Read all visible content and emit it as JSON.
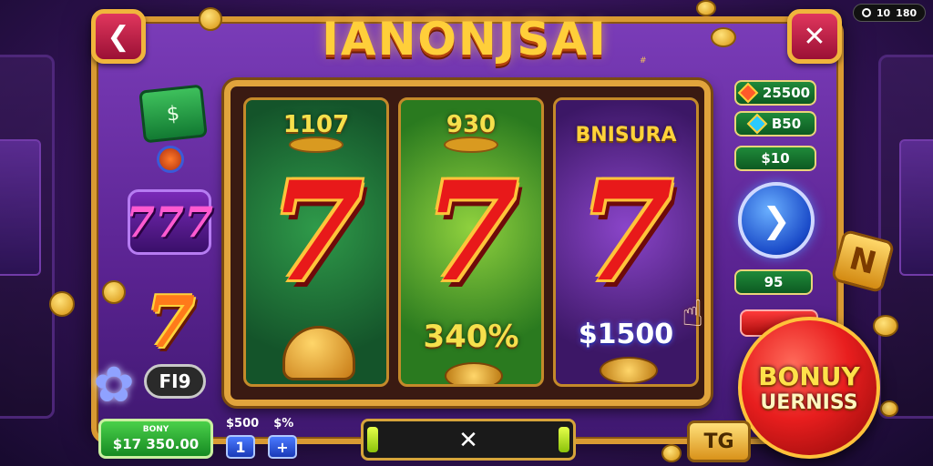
{
  "header": {
    "title": "IANONJSAI",
    "title_sub": "#",
    "back_icon": "chevron-left-icon",
    "close_icon": "close-icon",
    "counter": {
      "left": "10",
      "right": "180"
    }
  },
  "reels": [
    {
      "top": "1107",
      "symbol": "7",
      "bottom": ""
    },
    {
      "top": "930",
      "symbol": "7",
      "bottom": "340%"
    },
    {
      "top": "BNISURA",
      "symbol": "7",
      "bottom": "$1500"
    }
  ],
  "left_icons": {
    "cash_icon": "cash-icon",
    "label_777": "777",
    "label_7": "7",
    "flower": "✿",
    "fid_button": "FI9"
  },
  "paytable": [
    {
      "icon": "gem-icon",
      "value": "25500"
    },
    {
      "icon": "gem-icon",
      "value": "B50"
    },
    {
      "icon": "none",
      "value": "$10"
    },
    {
      "icon": "none",
      "value": "95"
    }
  ],
  "spin_icon": "chevron-right-icon",
  "bonus": {
    "line1": "BONUY",
    "line2": "UERNISS"
  },
  "floating_block": "N",
  "bottom": {
    "balance_label": "BONY",
    "balance_value": "$17 350.00",
    "bet_labels": [
      "$500",
      "$%"
    ],
    "bet_minus": "1",
    "bet_plus": "+",
    "progress_center": "✕",
    "tg_label": "TG"
  }
}
